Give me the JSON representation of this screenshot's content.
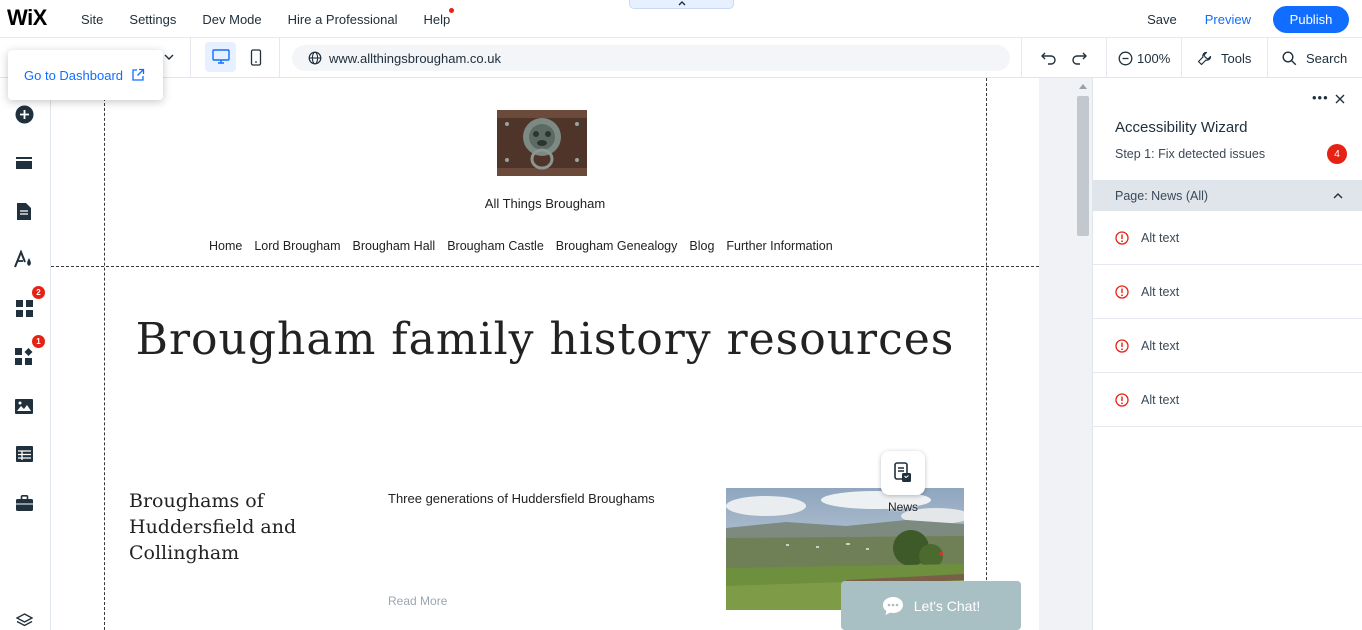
{
  "topbar": {
    "logo": "WiX",
    "nav": [
      {
        "label": "Site"
      },
      {
        "label": "Settings"
      },
      {
        "label": "Dev Mode"
      },
      {
        "label": "Hire a Professional"
      },
      {
        "label": "Help"
      }
    ],
    "save_label": "Save",
    "preview_label": "Preview",
    "publish_label": "Publish"
  },
  "toolbar": {
    "url": "www.allthingsbrougham.co.uk",
    "zoom": "100%",
    "tools_label": "Tools",
    "search_label": "Search"
  },
  "dashboard_popover": {
    "label": "Go to Dashboard"
  },
  "sidebar": {
    "badges": {
      "apps": "2",
      "extensions": "1"
    }
  },
  "site": {
    "name": "All Things Brougham",
    "nav": [
      "Home",
      "Lord Brougham",
      "Brougham Hall",
      "Brougham Castle",
      "Brougham Genealogy",
      "Blog",
      "Further Information"
    ],
    "page_title": "Brougham family history resources",
    "post": {
      "title": "Broughams of Huddersfield and Collingham",
      "excerpt": "Three generations of Huddersfield Broughams",
      "read_more": "Read More"
    },
    "news_label": "News",
    "chat_label": "Let's Chat!"
  },
  "panel": {
    "title": "Accessibility Wizard",
    "subtitle": "Step 1: Fix detected issues",
    "issue_count": "4",
    "section_label": "Page: News (All)",
    "issues": [
      {
        "label": "Alt text"
      },
      {
        "label": "Alt text"
      },
      {
        "label": "Alt text"
      },
      {
        "label": "Alt text"
      }
    ]
  },
  "colors": {
    "accent": "#116dff",
    "badge": "#e62214",
    "section_bg": "#dfe5eb",
    "chat_bg": "#a8bfc3"
  }
}
